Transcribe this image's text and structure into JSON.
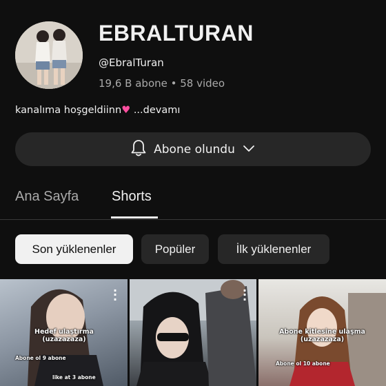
{
  "channel": {
    "name": "EBRALTURAN",
    "handle": "@EbralTuran",
    "stats": "19,6 B abone • 58 video",
    "description": "kanalıma hoşgeldiinn",
    "description_more": "...devamı"
  },
  "subscribe": {
    "label": "Abone olundu"
  },
  "tabs": [
    {
      "label": "Ana Sayfa",
      "selected": false
    },
    {
      "label": "Shorts",
      "selected": true
    }
  ],
  "chips": [
    {
      "label": "Son yüklenenler",
      "selected": true
    },
    {
      "label": "Popüler",
      "selected": false
    },
    {
      "label": "İlk yüklenenler",
      "selected": false
    }
  ],
  "shorts": [
    {
      "title_line1": "Hedef ulaştırma",
      "title_line2": "(uzazazaza)",
      "text_1": "Abone ol 9 abone",
      "text_2": "like at 3 abone"
    },
    {},
    {
      "title_line1": "Abone kitlesine ulaşma",
      "title_line2": "(uzazazaza)",
      "text_1": "Abone ol 10 abone"
    }
  ],
  "colors": {
    "background": "#0f0f0f",
    "chip_bg": "#272727",
    "chip_selected_bg": "#f1f1f1",
    "heart": "#ff4fa0"
  },
  "icons": {
    "bell": "bell-icon",
    "chevron": "chevron-down-icon",
    "heart": "heart-icon",
    "kebab": "more-vert-icon"
  }
}
